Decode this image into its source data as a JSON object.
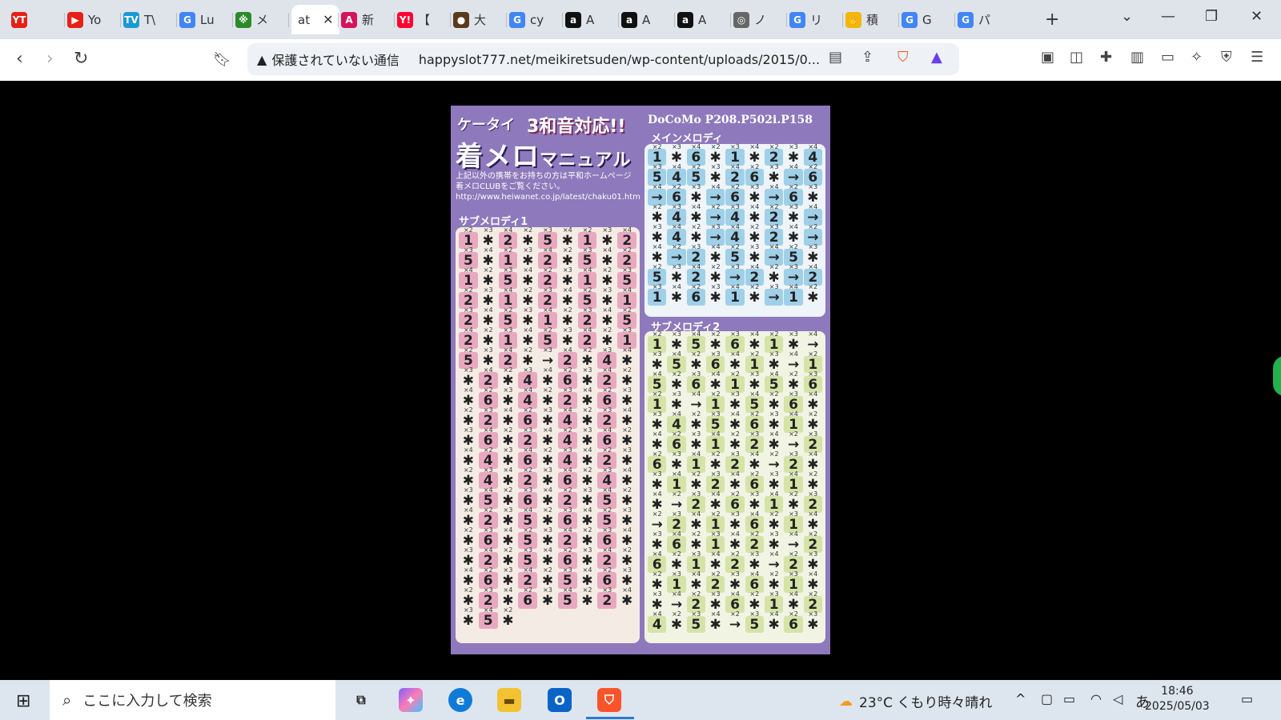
{
  "browser": {
    "tabs": [
      {
        "label": "",
        "fav": "YT",
        "color": "#e62117"
      },
      {
        "label": "Yo",
        "fav": "▶",
        "color": "#e62117"
      },
      {
        "label": "T\\",
        "fav": "TV",
        "color": "#1a9ad6"
      },
      {
        "label": "Lu",
        "fav": "G",
        "color": "#4285f4"
      },
      {
        "label": "メ",
        "fav": "※",
        "color": "#2a8a2a"
      },
      {
        "label": "at",
        "fav": "",
        "color": "#ffffff",
        "active": true
      },
      {
        "label": "新",
        "fav": "A",
        "color": "#d4145a"
      },
      {
        "label": "【",
        "fav": "Y!",
        "color": "#ff0033"
      },
      {
        "label": "大",
        "fav": "●",
        "color": "#5a3a1a"
      },
      {
        "label": "cy",
        "fav": "G",
        "color": "#4285f4"
      },
      {
        "label": "A",
        "fav": "a",
        "color": "#111111"
      },
      {
        "label": "A",
        "fav": "a",
        "color": "#111111"
      },
      {
        "label": "A",
        "fav": "a",
        "color": "#111111"
      },
      {
        "label": "ノ",
        "fav": "◎",
        "color": "#666666"
      },
      {
        "label": "リ",
        "fav": "G",
        "color": "#4285f4"
      },
      {
        "label": "積",
        "fav": "✋",
        "color": "#f2b705"
      },
      {
        "label": "G",
        "fav": "G",
        "color": "#4285f4"
      },
      {
        "label": "パ",
        "fav": "G",
        "color": "#4285f4"
      }
    ],
    "new_tab": "+",
    "security_text": "保護されていない通信",
    "url": "happyslot777.net/meikiretsuden/wp-content/uploads/2015/0..."
  },
  "manual": {
    "header_small": "ケータイ",
    "header_red": "3和音対応!!",
    "header_big": "着メロ",
    "header_big_suffix": "マニュアル",
    "device": "DoCoMo P208.P502i.P158",
    "note_lines": [
      "上記以外の携帯をお持ちの方は平和ホームページ",
      "着メロCLUBをご覧ください。",
      "http://www.heiwanet.co.jp/latest/chaku01.htm"
    ],
    "main_title": "メインメロディ",
    "sub1_title": "サブメロディ1",
    "sub2_title": "サブメロディ2"
  },
  "melody": {
    "main": [
      [
        "1",
        "*",
        "6",
        "*",
        "1",
        "*",
        "2",
        "*",
        "4"
      ],
      [
        "5",
        "4",
        "5",
        "*",
        "2",
        "6",
        "*",
        "→",
        "6"
      ],
      [
        "→",
        "6",
        "*",
        "→",
        "6",
        "*",
        "→",
        "6",
        "*"
      ],
      [
        "*",
        "4",
        "*",
        "→",
        "4",
        "*",
        "2",
        "*",
        "→"
      ],
      [
        "*",
        "4",
        "*",
        "→",
        "4",
        "*",
        "2",
        "*",
        "→"
      ],
      [
        "*",
        "→",
        "2",
        "*",
        "5",
        "*",
        "→",
        "5",
        "*"
      ],
      [
        "5",
        "*",
        "2",
        "*",
        "→",
        "2",
        "*",
        "→",
        "2"
      ],
      [
        "1",
        "*",
        "6",
        "*",
        "1",
        "*",
        "→",
        "1",
        "*"
      ]
    ],
    "sub1": [
      [
        "1",
        "*",
        "2",
        "*",
        "5",
        "*",
        "1",
        "*",
        "2"
      ],
      [
        "5",
        "*",
        "1",
        "*",
        "2",
        "*",
        "5",
        "*",
        "2"
      ],
      [
        "1",
        "*",
        "5",
        "*",
        "2",
        "*",
        "1",
        "*",
        "5"
      ],
      [
        "2",
        "*",
        "1",
        "*",
        "2",
        "*",
        "5",
        "*",
        "1"
      ],
      [
        "2",
        "*",
        "5",
        "*",
        "1",
        "*",
        "2",
        "*",
        "5"
      ],
      [
        "2",
        "*",
        "1",
        "*",
        "5",
        "*",
        "2",
        "*",
        "1"
      ],
      [
        "5",
        "*",
        "2",
        "*",
        "→",
        "2",
        "*",
        "4",
        "*"
      ],
      [
        "*",
        "2",
        "*",
        "4",
        "*",
        "6",
        "*",
        "2",
        "*"
      ],
      [
        "*",
        "6",
        "*",
        "4",
        "*",
        "2",
        "*",
        "6",
        "*"
      ],
      [
        "*",
        "2",
        "*",
        "6",
        "*",
        "4",
        "*",
        "2",
        "*"
      ],
      [
        "*",
        "6",
        "*",
        "2",
        "*",
        "4",
        "*",
        "6",
        "*"
      ],
      [
        "*",
        "4",
        "*",
        "6",
        "*",
        "4",
        "*",
        "2",
        "*"
      ],
      [
        "*",
        "4",
        "*",
        "2",
        "*",
        "6",
        "*",
        "4",
        "*"
      ],
      [
        "*",
        "5",
        "*",
        "6",
        "*",
        "2",
        "*",
        "5",
        "*"
      ],
      [
        "*",
        "2",
        "*",
        "5",
        "*",
        "6",
        "*",
        "5",
        "*"
      ],
      [
        "*",
        "6",
        "*",
        "5",
        "*",
        "2",
        "*",
        "6",
        "*"
      ],
      [
        "*",
        "2",
        "*",
        "5",
        "*",
        "6",
        "*",
        "2",
        "*"
      ],
      [
        "*",
        "6",
        "*",
        "2",
        "*",
        "5",
        "*",
        "6",
        "*"
      ],
      [
        "*",
        "2",
        "*",
        "6",
        "*",
        "5",
        "*",
        "2",
        "*"
      ],
      [
        "*",
        "5",
        "*",
        "",
        "",
        "",
        "",
        "",
        ""
      ]
    ],
    "sub2": [
      [
        "1",
        "*",
        "5",
        "*",
        "6",
        "*",
        "1",
        "*",
        "→"
      ],
      [
        "*",
        "5",
        "*",
        "6",
        "*",
        "1",
        "*",
        "→",
        "1"
      ],
      [
        "5",
        "*",
        "6",
        "*",
        "1",
        "*",
        "5",
        "*",
        "6"
      ],
      [
        "1",
        "*",
        "→",
        "1",
        "*",
        "5",
        "*",
        "6",
        "*"
      ],
      [
        "*",
        "4",
        "*",
        "5",
        "*",
        "6",
        "*",
        "1",
        "*"
      ],
      [
        "*",
        "6",
        "*",
        "1",
        "*",
        "2",
        "*",
        "→",
        "2"
      ],
      [
        "6",
        "*",
        "1",
        "*",
        "2",
        "*",
        "→",
        "2",
        "*"
      ],
      [
        "*",
        "1",
        "*",
        "2",
        "*",
        "6",
        "*",
        "1",
        "*"
      ],
      [
        "*",
        "→",
        "2",
        "*",
        "6",
        "*",
        "1",
        "*",
        "2"
      ],
      [
        "→",
        "2",
        "*",
        "1",
        "*",
        "6",
        "*",
        "1",
        "*"
      ],
      [
        "*",
        "6",
        "*",
        "1",
        "*",
        "2",
        "*",
        "→",
        "2"
      ],
      [
        "6",
        "*",
        "1",
        "*",
        "2",
        "*",
        "→",
        "2",
        "*"
      ],
      [
        "*",
        "1",
        "*",
        "2",
        "*",
        "6",
        "*",
        "1",
        "*"
      ],
      [
        "*",
        "→",
        "2",
        "*",
        "6",
        "*",
        "1",
        "*",
        "2"
      ],
      [
        "4",
        "*",
        "5",
        "*",
        "→",
        "5",
        "*",
        "6",
        "*"
      ]
    ]
  },
  "taskbar": {
    "search_placeholder": "ここに入力して検索",
    "weather": "23°C くもり時々晴れ",
    "time": "18:46",
    "date": "2025/05/03",
    "ime": "あ"
  }
}
